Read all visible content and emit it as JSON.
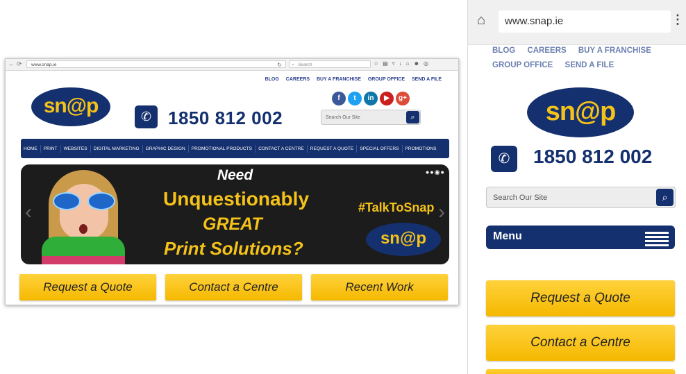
{
  "desktop": {
    "url": "www.snap.ie",
    "search_placeholder": "Search",
    "top_links": [
      "BLOG",
      "CAREERS",
      "BUY A FRANCHISE",
      "GROUP OFFICE",
      "SEND A FILE"
    ],
    "logo": "sn@p",
    "phone": "1850 812 002",
    "social": [
      "f",
      "t",
      "in",
      "▶",
      "g+"
    ],
    "site_search_placeholder": "Search Our Site",
    "nav": [
      "HOME",
      "PRINT",
      "WEBSITES",
      "DIGITAL MARKETING",
      "GRAPHIC DESIGN",
      "PROMOTIONAL PRODUCTS",
      "CONTACT A CENTRE",
      "REQUEST A QUOTE",
      "SPECIAL OFFERS",
      "PROMOTIONS"
    ],
    "banner": {
      "line_need": "Need",
      "line1": "Unquestionably",
      "line2": "GREAT",
      "line3": "Print Solutions?",
      "hashtag": "#TalkToSnap",
      "logo": "sn@p"
    },
    "buttons": [
      "Request a Quote",
      "Contact a Centre",
      "Recent Work"
    ]
  },
  "mobile": {
    "url": "www.snap.ie",
    "links_row1": [
      "BLOG",
      "CAREERS",
      "BUY A FRANCHISE"
    ],
    "links_row2": [
      "GROUP OFFICE",
      "SEND A FILE"
    ],
    "logo": "sn@p",
    "phone": "1850 812 002",
    "search_placeholder": "Search Our Site",
    "menu_label": "Menu",
    "buttons": [
      "Request a Quote",
      "Contact a Centre"
    ]
  },
  "colors": {
    "brand_navy": "#14306e",
    "brand_yellow": "#f4c219",
    "facebook": "#3b5998",
    "twitter": "#1da1f2",
    "linkedin": "#0e76a8",
    "youtube": "#cc2020",
    "googleplus": "#dd4b39"
  }
}
